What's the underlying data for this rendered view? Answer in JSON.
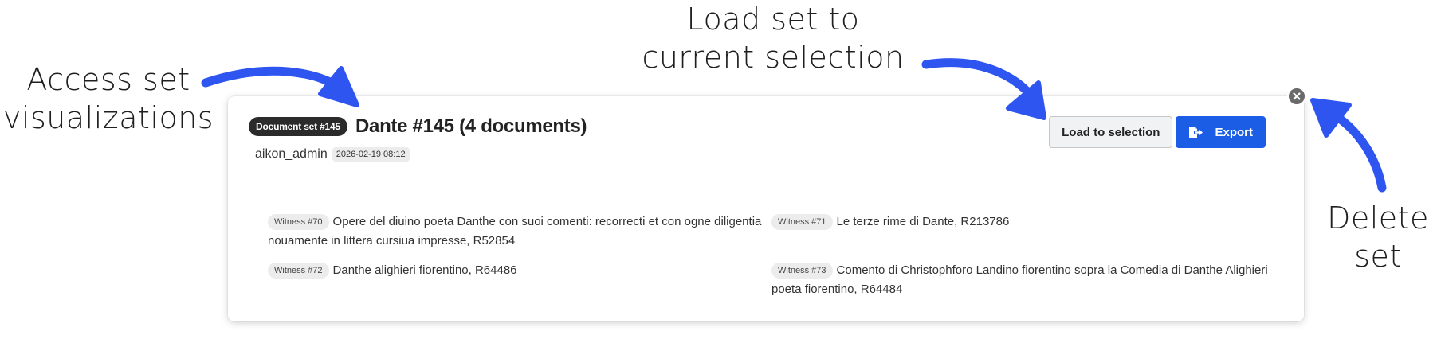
{
  "annotations": {
    "access_line1": "Access set",
    "access_line2": "visualizations",
    "load_line1": "Load set to",
    "load_line2": "current selection",
    "delete_line1": "Delete",
    "delete_line2": "set"
  },
  "card": {
    "badge": "Document set #145",
    "title": "Dante #145 (4 documents)",
    "user": "aikon_admin",
    "date": "2026-02-19 08:12",
    "load_button": "Load to selection",
    "export_button": "Export",
    "witnesses": [
      {
        "tag": "Witness #70",
        "text": "Opere del diuino poeta Danthe con suoi comenti: recorrecti et con ogne diligentia nouamente in littera cursiua impresse, R52854"
      },
      {
        "tag": "Witness #71",
        "text": "Le terze rime di Dante, R213786"
      },
      {
        "tag": "Witness #72",
        "text": "Danthe alighieri fiorentino, R64486"
      },
      {
        "tag": "Witness #73",
        "text": "Comento di Christophforo Landino fiorentino sopra la Comedia di Danthe Alighieri poeta fiorentino, R64484"
      }
    ]
  },
  "colors": {
    "arrow": "#2f55f0",
    "primary_button": "#1c5de6",
    "badge_bg": "#2b2b2b",
    "close_button": "#6a6a6a"
  },
  "icons": {
    "export": "file-export-icon",
    "delete": "close-circle-icon"
  }
}
